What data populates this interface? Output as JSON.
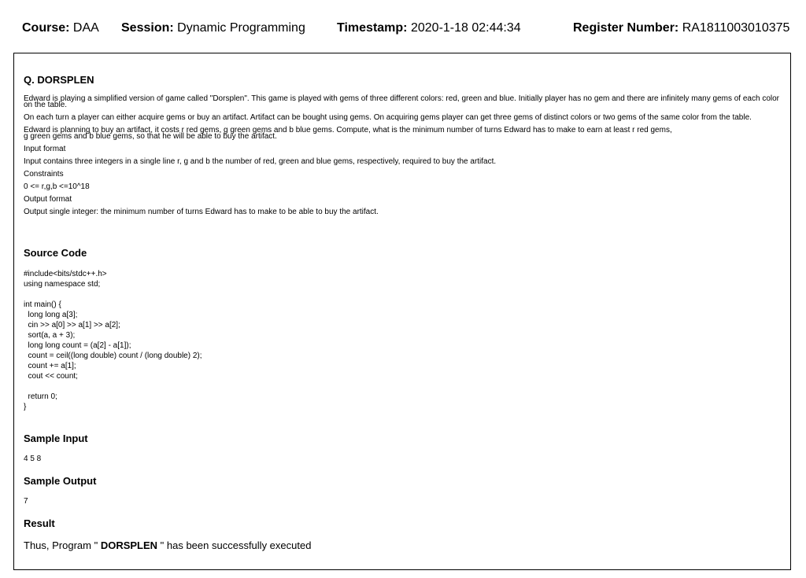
{
  "header": {
    "course_label": "Course:",
    "course_value": "DAA",
    "session_label": "Session:",
    "session_value": "Dynamic Programming",
    "timestamp_label": "Timestamp:",
    "timestamp_value": "2020-1-18 02:44:34",
    "register_label": "Register Number:",
    "register_value": "RA1811003010375"
  },
  "question": {
    "title": "Q. DORSPLEN",
    "para1_line1": "Edward is playing a simplified version of game called \"Dorsplen\". This game is played with gems of three different colors: red, green and blue. Initially player has no gem and there are infinitely many gems of each color",
    "para1_line2": "on the table.",
    "para2": "On each turn a player can either acquire gems or buy an artifact. Artifact can be bought using gems. On acquiring gems player can get three gems of distinct colors or two gems of the same color from the table.",
    "para3_line1": "Edward is planning to buy an artifact, it costs r red gems, g green gems and b blue gems. Compute, what is the minimum number of turns Edward has to make to earn at least r red gems,",
    "para3_line2": "g green gems and b blue gems, so that he will be able to buy the artifact.",
    "input_format_label": "Input format",
    "input_format_text": "Input contains three integers in a single line r, g and b the number of red, green and blue gems, respectively, required to buy the artifact.",
    "constraints_label": "Constraints",
    "constraints_text": "0 <= r,g,b <=10^18",
    "output_format_label": "Output format",
    "output_format_text": "Output single integer: the minimum number of turns Edward has to make to be able to buy the artifact."
  },
  "source": {
    "heading": "Source Code",
    "code": "#include<bits/stdc++.h>\nusing namespace std;\n\nint main() {\n  long long a[3];\n  cin >> a[0] >> a[1] >> a[2];\n  sort(a, a + 3);\n  long long count = (a[2] - a[1]);\n  count = ceil((long double) count / (long double) 2);\n  count += a[1];\n  cout << count;\n\n  return 0;\n}"
  },
  "sample_input": {
    "heading": "Sample Input",
    "value": "4 5 8"
  },
  "sample_output": {
    "heading": "Sample Output",
    "value": "7"
  },
  "result": {
    "heading": "Result",
    "prefix": "Thus, Program \" ",
    "program": "DORSPLEN",
    "suffix": " \" has been successfully executed"
  }
}
